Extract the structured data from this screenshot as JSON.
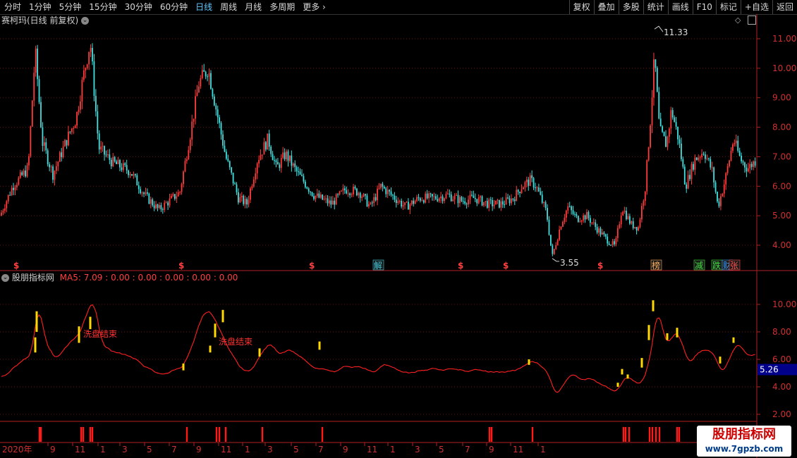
{
  "toolbar": {
    "periods": [
      "分时",
      "1分钟",
      "5分钟",
      "15分钟",
      "30分钟",
      "60分钟",
      "日线",
      "周线",
      "月线",
      "多周期",
      "更多 ›"
    ],
    "active_period": "日线",
    "functions": [
      "复权",
      "叠加",
      "多股",
      "统计",
      "画线",
      "F10",
      "标记",
      "+自选",
      "返回"
    ]
  },
  "main_panel": {
    "title": "赛柯玛(日线 前复权)",
    "y_ticks": [
      "11.00",
      "10.00",
      "9.00",
      "8.00",
      "7.00",
      "6.00",
      "5.00",
      "4.00"
    ],
    "high_label": "11.33",
    "low_label": "3.55",
    "event_markers": [
      {
        "text": "$",
        "color": "#ff4040"
      },
      {
        "text": "$",
        "color": "#ff4040"
      },
      {
        "text": "$",
        "color": "#ff4040"
      },
      {
        "text": "解",
        "color": "#3fd0e0"
      },
      {
        "text": "$",
        "color": "#ff4040"
      },
      {
        "text": "$",
        "color": "#ff4040"
      },
      {
        "text": "$",
        "color": "#ff4040"
      },
      {
        "text": "榜",
        "color": "#ffb060"
      },
      {
        "text": "减",
        "color": "#40e040"
      },
      {
        "text": "跌",
        "color": "#40e040"
      },
      {
        "text": "财",
        "color": "#40a0ff"
      },
      {
        "text": "张",
        "color": "#ff5050"
      }
    ]
  },
  "indicator_panel": {
    "title": "股朋指标网",
    "params_text": "MA5: 7.09 : 0.00 : 0.00 : 0.00 : 0.00 : 0.00",
    "y_ticks": [
      "10.00",
      "8.00",
      "6.00",
      "4.00",
      "2.00"
    ],
    "current_value": "5.26",
    "annotations": [
      "洗盘结束",
      "洗盘结束"
    ]
  },
  "x_axis": {
    "year_label": "2020年",
    "month_labels": [
      "9",
      "11",
      "1",
      "3",
      "5",
      "7",
      "9",
      "11",
      "1",
      "3",
      "5",
      "7",
      "9",
      "11",
      "1",
      "3",
      "5",
      "7",
      "9",
      "11",
      "1"
    ]
  },
  "watermark": {
    "title": "股朋指标网",
    "url": "www.7gpzb.com"
  },
  "colors": {
    "up": "#ff3c3c",
    "down": "#40e0e0",
    "axis": "#b02020",
    "indicator_line": "#ff2020",
    "signal": "#ffd800",
    "active_tab": "#5fc8ff"
  },
  "chart_data": {
    "type": "candlestick",
    "title": "赛柯玛(日线 前复权)",
    "ylim": [
      3.5,
      11.6
    ],
    "max": 11.33,
    "min": 3.55,
    "x_labels": [
      "2020年",
      "9",
      "11",
      "1",
      "3",
      "5",
      "7",
      "9",
      "11",
      "1",
      "3",
      "5",
      "7",
      "9",
      "11",
      "1",
      "3",
      "5",
      "7",
      "9",
      "11",
      "1"
    ],
    "close_trend": [
      {
        "label": "2020年",
        "close": 5.6
      },
      {
        "label": "9",
        "close": 6.5
      },
      {
        "label": "11",
        "close": 8.8
      },
      {
        "label": "1",
        "close": 6.6
      },
      {
        "label": "3",
        "close": 5.2
      },
      {
        "label": "5",
        "close": 7.9
      },
      {
        "label": "7",
        "close": 5.8
      },
      {
        "label": "9",
        "close": 7.1
      },
      {
        "label": "11",
        "close": 5.9
      },
      {
        "label": "1",
        "close": 5.5
      },
      {
        "label": "3",
        "close": 5.6
      },
      {
        "label": "5",
        "close": 5.4
      },
      {
        "label": "7",
        "close": 5.2
      },
      {
        "label": "9",
        "close": 5.8
      },
      {
        "label": "11",
        "close": 4.5
      },
      {
        "label": "1",
        "close": 4.9
      },
      {
        "label": "3",
        "close": 4.1
      },
      {
        "label": "5",
        "close": 4.6
      },
      {
        "label": "7",
        "close": 9.5
      },
      {
        "label": "9",
        "close": 6.6
      },
      {
        "label": "11",
        "close": 6.3
      },
      {
        "label": "1",
        "close": 7.0
      }
    ],
    "indicator": {
      "name": "MA5",
      "ylim": [
        1.5,
        11.5
      ],
      "last_value": 5.26
    }
  }
}
